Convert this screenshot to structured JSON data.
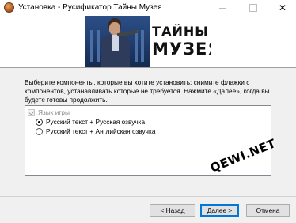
{
  "window": {
    "title": "Установка - Русификатор Тайны Музея",
    "icon": "installer-app-icon",
    "controls": [
      "minimize-icon",
      "maximize-icon",
      "close-icon"
    ]
  },
  "banner": {
    "logo_line1": "ТАЙНЫ",
    "logo_line2": "МУЗЕЯ"
  },
  "content": {
    "description": "Выберите компоненты, которые вы хотите установить; снимите флажки с компонентов, устанавливать которые не требуется. Нажмите «Далее», когда вы будете готовы продолжить.",
    "group_label": "Язык игры",
    "group_checked": true,
    "options": [
      {
        "label": "Русский текст + Русская озвучка",
        "selected": true
      },
      {
        "label": "Русский текст + Английская озвучка",
        "selected": false
      }
    ]
  },
  "watermark": "QEWI.NET",
  "buttons": {
    "back": "< Назад",
    "next": "Далее >",
    "cancel": "Отмена"
  },
  "colors": {
    "accent": "#0078d7",
    "panel_bg": "#f0f0f0"
  }
}
